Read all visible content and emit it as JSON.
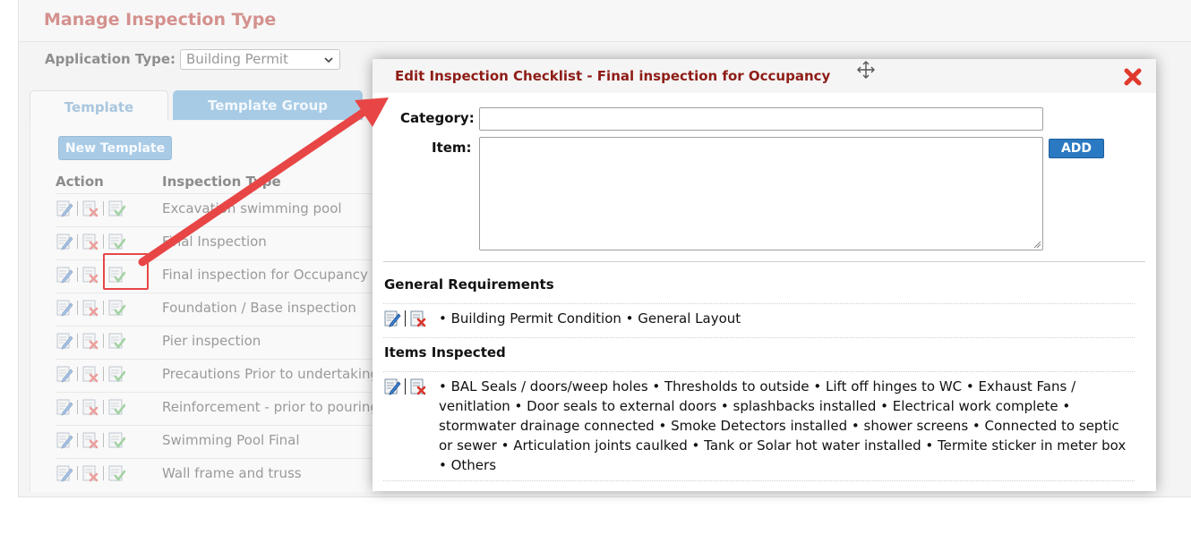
{
  "page": {
    "title": "Manage Inspection Type",
    "application_type_label": "Application Type:",
    "application_type_value": "Building Permit"
  },
  "tabs": [
    {
      "label": "Template"
    },
    {
      "label": "Template Group"
    }
  ],
  "new_template_label": "New Template",
  "columns": {
    "action": "Action",
    "inspection_type": "Inspection Type"
  },
  "rows": [
    {
      "label": "Excavation swimming pool"
    },
    {
      "label": "Final Inspection"
    },
    {
      "label": "Final inspection for Occupancy"
    },
    {
      "label": "Foundation / Base inspection"
    },
    {
      "label": "Pier inspection"
    },
    {
      "label": "Precautions Prior to undertaking"
    },
    {
      "label": "Reinforcement - prior to pouring"
    },
    {
      "label": "Swimming Pool Final"
    },
    {
      "label": "Wall frame and truss"
    }
  ],
  "modal": {
    "title": "Edit Inspection Checklist - Final inspection for Occupancy",
    "category_label": "Category:",
    "category_value": "",
    "item_label": "Item:",
    "item_value": "",
    "add_label": "ADD",
    "sections": [
      {
        "title": "General Requirements",
        "items_text": "• Building Permit Condition • General Layout"
      },
      {
        "title": "Items Inspected",
        "items_text": "• BAL Seals / doors/weep holes • Thresholds to outside • Lift off hinges to WC • Exhaust Fans / venitlation • Door seals to external doors • splashbacks installed • Electrical work complete • stormwater drainage connected • Smoke Detectors installed • shower screens • Connected to septic or sewer • Articulation joints caulked • Tank or Solar hot water installed • Termite sticker in meter box • Others"
      }
    ]
  },
  "colors": {
    "page_title": "#d4918e",
    "modal_title": "#8e1d17",
    "tab_active_bg": "#a7cbe5",
    "add_button": "#2a79c2",
    "annotation_arrow": "#e84646"
  },
  "icons": [
    "chevron-down-icon",
    "edit-icon",
    "delete-icon",
    "checklist-icon",
    "move-icon",
    "close-icon",
    "resize-grip-icon"
  ]
}
